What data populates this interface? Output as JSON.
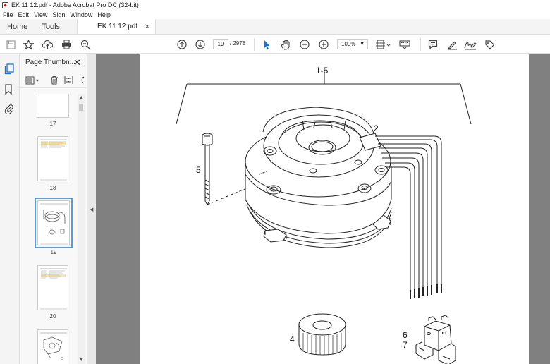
{
  "window": {
    "title": "EK 11 12.pdf - Adobe Acrobat Pro DC (32-bit)"
  },
  "menu": [
    "File",
    "Edit",
    "View",
    "Sign",
    "Window",
    "Help"
  ],
  "tabs": {
    "home": "Home",
    "tools": "Tools",
    "document": "EK 11 12.pdf",
    "close_glyph": "×"
  },
  "toolbar": {
    "current_page": "19",
    "page_total": "/  2978",
    "zoom": "100%",
    "icons": [
      "save-icon",
      "bookmark-star-icon",
      "upload-icon",
      "print-icon",
      "search-zoom-icon",
      "prev-page-icon",
      "next-page-icon",
      "select-arrow-icon",
      "hand-icon",
      "zoom-out-icon",
      "zoom-in-icon",
      "fit-page-icon",
      "keyboard-icon",
      "comment-icon",
      "highlight-pen-icon",
      "sign-icon",
      "share-tag-icon"
    ]
  },
  "thumbnail_panel": {
    "title": "Page Thumbn...",
    "close_glyph": "✕",
    "pages": [
      {
        "label": "17"
      },
      {
        "label": "18"
      },
      {
        "label": "19",
        "selected": true
      },
      {
        "label": "20"
      },
      {
        "label": ""
      }
    ]
  },
  "drawing": {
    "callouts": {
      "group": "1-5",
      "part2": "2",
      "part5": "5",
      "part4": "4",
      "part6": "6",
      "part7": "7"
    }
  },
  "colors": {
    "accent": "#1473e6",
    "doc_background": "#808080",
    "selection": "#5b9bd5",
    "brand_red": "#dd0000"
  }
}
